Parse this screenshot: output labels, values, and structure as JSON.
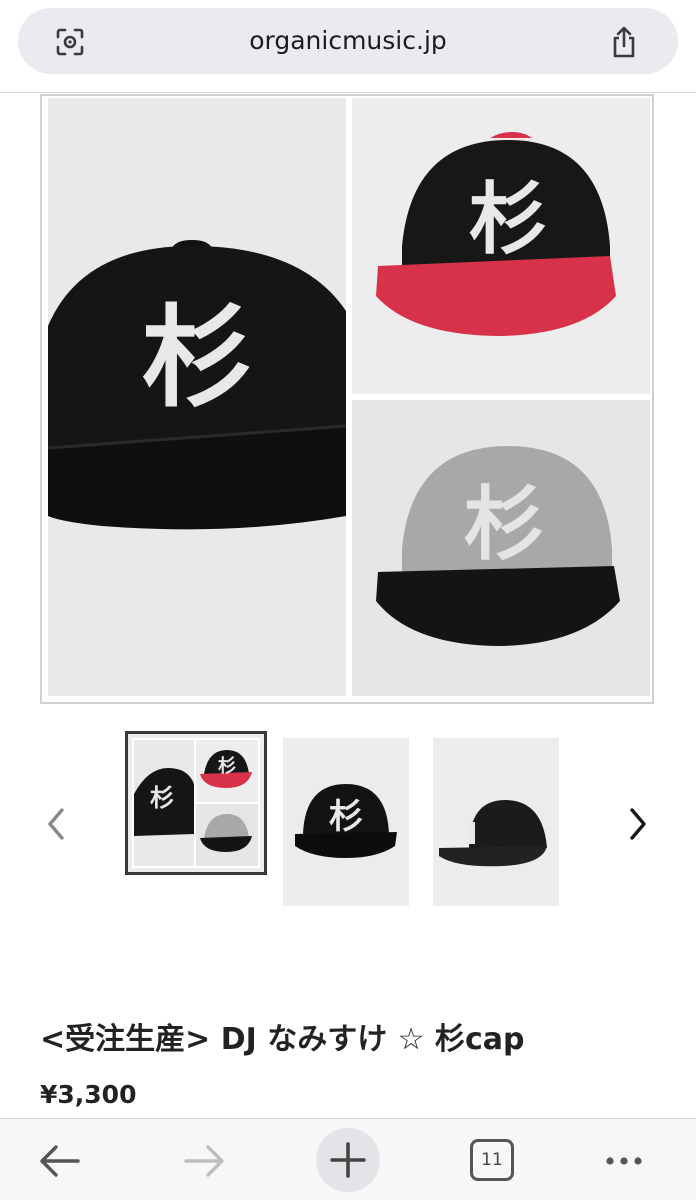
{
  "browser": {
    "url": "organicmusic.jp",
    "tab_count": "11"
  },
  "gallery": {
    "main_image_alt": "",
    "cap_letter": "杉",
    "thumbnails": [
      {
        "kind": "collage",
        "selected": true
      },
      {
        "kind": "black-front",
        "selected": false
      },
      {
        "kind": "black-side",
        "selected": false
      }
    ]
  },
  "product": {
    "title": "<受注生産> DJ なみすけ ☆ 杉cap",
    "price": "¥3,300"
  },
  "icons": {
    "lens": "visual-lookup-icon",
    "share": "share-icon",
    "back": "back-arrow-icon",
    "forward": "forward-arrow-icon",
    "new_tab": "plus-icon",
    "tabs": "tabs-icon",
    "more": "more-icon",
    "prev": "chevron-left-icon",
    "next": "chevron-right-icon"
  },
  "colors": {
    "cap_black": "#141414",
    "cap_red": "#d8324a",
    "cap_gray": "#a8a8a8",
    "embroidery": "#e8e8e8"
  }
}
